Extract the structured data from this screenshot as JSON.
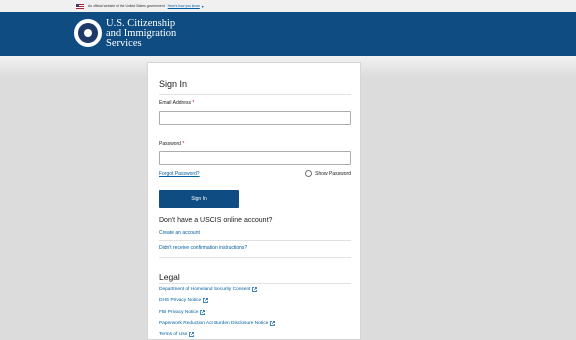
{
  "gov_banner": {
    "text": "An official website of the United States government",
    "link": "Here's how you know"
  },
  "header": {
    "line1": "U.S. Citizenship",
    "line2": "and Immigration",
    "line3": "Services"
  },
  "signin": {
    "title": "Sign In",
    "email_label": "Email Address",
    "password_label": "Password",
    "required_mark": "*",
    "forgot_password": "Forgot Password?",
    "show_password": "Show Password",
    "button": "Sign In"
  },
  "account": {
    "heading": "Don't have a USCIS online account?",
    "create": "Create an account",
    "confirmation": "Didn't receive confirmation instructions?"
  },
  "legal": {
    "heading": "Legal",
    "links": [
      "Department of Homeland Security Consent",
      "DHS Privacy Notice",
      "FBI Privacy Notice",
      "Paperwork Reduction Act Burden Disclosure Notice",
      "Terms of Use"
    ]
  },
  "colors": {
    "header_bg": "#0f4c81",
    "link": "#005ea2",
    "required": "#b50909"
  }
}
